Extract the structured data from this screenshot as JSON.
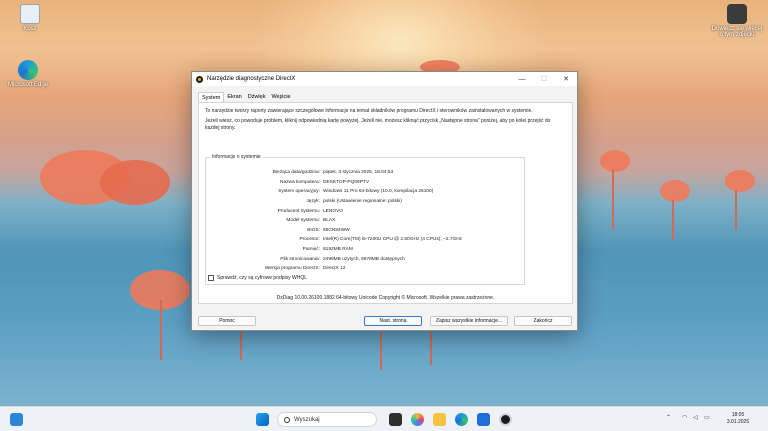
{
  "desktop": {
    "icons": [
      {
        "label": "Kosz"
      },
      {
        "label": "Microsoft Edge"
      },
      {
        "label": "Dowiedz się więcej o tym zdjęciu"
      }
    ]
  },
  "window": {
    "title": "Narzędzie diagnostyczne DirectX",
    "controls": {
      "minimize": "—",
      "maximize": "☐",
      "close": "✕"
    },
    "tabs": [
      "System",
      "Ekran",
      "Dźwięk",
      "Wejście"
    ],
    "intro1": "To narzędzie tworzy raporty zawierające szczegółowe informacje na temat składników programu DirectX i sterowników zainstalowanych w systemie.",
    "intro2": "Jeżeli wiesz, co powoduje problem, kliknij odpowiednią kartę powyżej. Jeżeli nie, możesz kliknąć przycisk „Następne strona” poniżej, aby po kolei przejść do każdej strony.",
    "group_title": "Informacje o systemie",
    "rows": [
      {
        "label": "Bieżąca data/godzina:",
        "value": "piątek, 3 stycznia 2025, 18:04:53"
      },
      {
        "label": "Nazwa komputera:",
        "value": "DESKTOP-PQ09PTV"
      },
      {
        "label": "System operacyjny:",
        "value": "Windows 11 Pro 64-bitowy (10.0, kompilacja 26100)"
      },
      {
        "label": "Język:",
        "value": "polski (Ustawienie regionalne: polski)"
      },
      {
        "label": "Producent systemu:",
        "value": "LENOVO"
      },
      {
        "label": "Model systemu:",
        "value": "BLAX"
      },
      {
        "label": "BIOS:",
        "value": "65CN94WW"
      },
      {
        "label": "Procesor:",
        "value": "Intel(R) Core(TM) i5-7200U CPU @ 2.50GHz (4 CPUs), ~2.7GHz"
      },
      {
        "label": "Pamięć:",
        "value": "8192MB RAM"
      },
      {
        "label": "Plik stronicowania:",
        "value": "2499MB użytych, 6978MB dostępnych"
      },
      {
        "label": "Wersja programu DirectX:",
        "value": "DirectX 12"
      }
    ],
    "whql_label": "Sprawdź, czy są cyfrowe podpisy WHQL",
    "version_note": "DxDiag 10.00.26100.1882 64-bitowy Unicode  Copyright © Microsoft. Wszelkie prawa zastrzeżone.",
    "buttons": {
      "help": "Pomoc",
      "next": "Nast. strona",
      "save": "Zapisz wszystkie informacje...",
      "exit": "Zakończ"
    }
  },
  "taskbar": {
    "search_placeholder": "Wyszukaj",
    "time": "18:05",
    "date": "3.01.2025"
  }
}
